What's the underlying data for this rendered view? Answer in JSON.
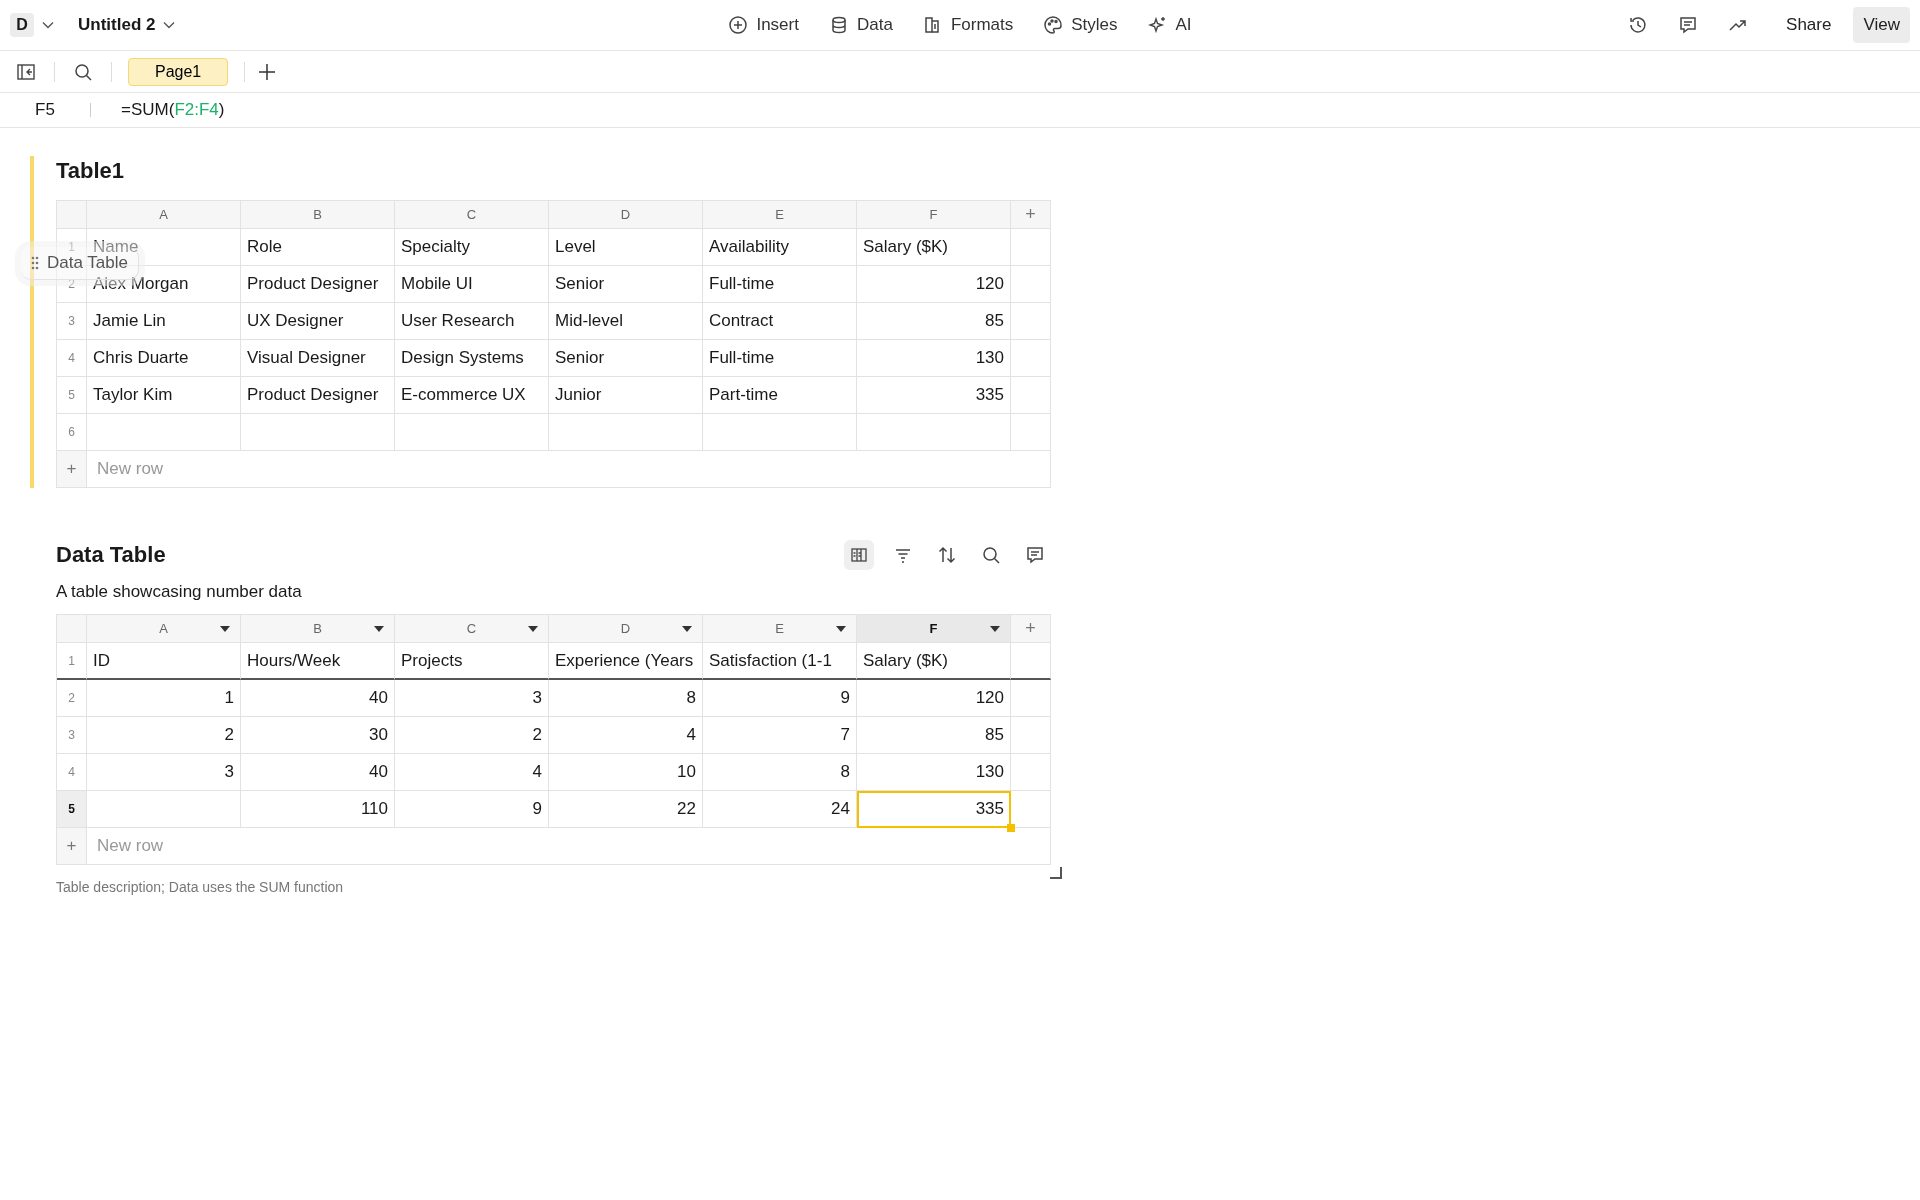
{
  "topbar": {
    "doc_initial": "D",
    "title": "Untitled 2",
    "menu": [
      {
        "kind": "insert",
        "label": "Insert"
      },
      {
        "kind": "data",
        "label": "Data"
      },
      {
        "kind": "formats",
        "label": "Formats"
      },
      {
        "kind": "styles",
        "label": "Styles"
      },
      {
        "kind": "ai",
        "label": "AI"
      }
    ],
    "right_icons": [
      {
        "kind": "history"
      },
      {
        "kind": "comment"
      },
      {
        "kind": "trend"
      }
    ],
    "buttons": [
      {
        "label": "Share",
        "selected": false
      },
      {
        "label": "View",
        "selected": true
      }
    ]
  },
  "pages": [
    {
      "label": "Page1",
      "selected": true
    }
  ],
  "formula_bar": {
    "cell": "F5",
    "formula_start": "=SUM(",
    "reference": "F2:F4",
    "formula_end": ")"
  },
  "tables": [
    {
      "title": "Table1",
      "highlighted": true,
      "drag_label": "Data Table",
      "columns": [
        {
          "label": "A",
          "selected": false,
          "menu": false
        },
        {
          "label": "B",
          "selected": false,
          "menu": false
        },
        {
          "label": "C",
          "selected": false,
          "menu": false
        },
        {
          "label": "D",
          "selected": false,
          "menu": false
        },
        {
          "label": "E",
          "selected": false,
          "menu": false
        },
        {
          "label": "F",
          "selected": false,
          "menu": false
        }
      ],
      "add_column": "+",
      "rows": [
        {
          "number": "1",
          "selected": false,
          "header": false,
          "cells": [
            {
              "kind": "text",
              "text": "Name",
              "selected": false
            },
            {
              "kind": "text",
              "text": "Role",
              "selected": false
            },
            {
              "kind": "text",
              "text": "Specialty",
              "selected": false
            },
            {
              "kind": "text",
              "text": "Level",
              "selected": false
            },
            {
              "kind": "text",
              "text": "Availability",
              "selected": false
            },
            {
              "kind": "text",
              "text": "Salary ($K)",
              "selected": false
            }
          ]
        },
        {
          "number": "2",
          "selected": false,
          "header": false,
          "cells": [
            {
              "kind": "text",
              "text": "Alex Morgan",
              "selected": false
            },
            {
              "kind": "text",
              "text": "Product Designer",
              "selected": false
            },
            {
              "kind": "text",
              "text": "Mobile UI",
              "selected": false
            },
            {
              "kind": "text",
              "text": "Senior",
              "selected": false
            },
            {
              "kind": "text",
              "text": "Full-time",
              "selected": false
            },
            {
              "kind": "number",
              "text": "120",
              "selected": false
            }
          ]
        },
        {
          "number": "3",
          "selected": false,
          "header": false,
          "cells": [
            {
              "kind": "text",
              "text": "Jamie Lin",
              "selected": false
            },
            {
              "kind": "text",
              "text": "UX Designer",
              "selected": false
            },
            {
              "kind": "text",
              "text": "User Research",
              "selected": false
            },
            {
              "kind": "text",
              "text": "Mid-level",
              "selected": false
            },
            {
              "kind": "text",
              "text": "Contract",
              "selected": false
            },
            {
              "kind": "number",
              "text": "85",
              "selected": false
            }
          ]
        },
        {
          "number": "4",
          "selected": false,
          "header": false,
          "cells": [
            {
              "kind": "text",
              "text": "Chris Duarte",
              "selected": false
            },
            {
              "kind": "text",
              "text": "Visual Designer",
              "selected": false
            },
            {
              "kind": "text",
              "text": "Design Systems",
              "selected": false
            },
            {
              "kind": "text",
              "text": "Senior",
              "selected": false
            },
            {
              "kind": "text",
              "text": "Full-time",
              "selected": false
            },
            {
              "kind": "number",
              "text": "130",
              "selected": false
            }
          ]
        },
        {
          "number": "5",
          "selected": false,
          "header": false,
          "cells": [
            {
              "kind": "text",
              "text": "Taylor Kim",
              "selected": false
            },
            {
              "kind": "text",
              "text": "Product Designer",
              "selected": false
            },
            {
              "kind": "text",
              "text": "E-commerce UX",
              "selected": false
            },
            {
              "kind": "text",
              "text": "Junior",
              "selected": false
            },
            {
              "kind": "text",
              "text": "Part-time",
              "selected": false
            },
            {
              "kind": "number",
              "text": "335",
              "selected": false
            }
          ]
        },
        {
          "number": "6",
          "selected": false,
          "header": false,
          "cells": [
            {
              "kind": "empty",
              "selected": false
            },
            {
              "kind": "empty",
              "selected": false
            },
            {
              "kind": "empty",
              "selected": false
            },
            {
              "kind": "empty",
              "selected": false
            },
            {
              "kind": "empty",
              "selected": false
            },
            {
              "kind": "empty",
              "selected": false
            }
          ]
        }
      ],
      "new_row": {
        "icon": "+",
        "label": "New row"
      }
    },
    {
      "title": "Data Table",
      "highlighted": false,
      "description": "A table showcasing number data",
      "tools": [
        {
          "kind": "columns",
          "selected": true
        },
        {
          "kind": "filter",
          "selected": false
        },
        {
          "kind": "sort",
          "selected": false
        },
        {
          "kind": "search",
          "selected": false
        },
        {
          "kind": "comment",
          "selected": false
        }
      ],
      "columns": [
        {
          "label": "A",
          "selected": false,
          "menu": true
        },
        {
          "label": "B",
          "selected": false,
          "menu": true
        },
        {
          "label": "C",
          "selected": false,
          "menu": true
        },
        {
          "label": "D",
          "selected": false,
          "menu": true
        },
        {
          "label": "E",
          "selected": false,
          "menu": true
        },
        {
          "label": "F",
          "selected": true,
          "menu": true
        }
      ],
      "add_column": "+",
      "rows": [
        {
          "number": "1",
          "selected": false,
          "header": true,
          "cells": [
            {
              "kind": "text",
              "text": "ID",
              "selected": false
            },
            {
              "kind": "text",
              "text": "Hours/Week",
              "selected": false
            },
            {
              "kind": "text",
              "text": "Projects",
              "selected": false
            },
            {
              "kind": "text",
              "text": "Experience (Years",
              "selected": false
            },
            {
              "kind": "text",
              "text": "Satisfaction (1-1",
              "selected": false
            },
            {
              "kind": "text",
              "text": "Salary ($K)",
              "selected": false
            }
          ]
        },
        {
          "number": "2",
          "selected": false,
          "header": false,
          "cells": [
            {
              "kind": "number",
              "text": "1",
              "selected": false
            },
            {
              "kind": "number",
              "text": "40",
              "selected": false
            },
            {
              "kind": "number",
              "text": "3",
              "selected": false
            },
            {
              "kind": "number",
              "text": "8",
              "selected": false
            },
            {
              "kind": "number",
              "text": "9",
              "selected": false
            },
            {
              "kind": "number",
              "text": "120",
              "selected": false
            }
          ]
        },
        {
          "number": "3",
          "selected": false,
          "header": false,
          "cells": [
            {
              "kind": "number",
              "text": "2",
              "selected": false
            },
            {
              "kind": "number",
              "text": "30",
              "selected": false
            },
            {
              "kind": "number",
              "text": "2",
              "selected": false
            },
            {
              "kind": "number",
              "text": "4",
              "selected": false
            },
            {
              "kind": "number",
              "text": "7",
              "selected": false
            },
            {
              "kind": "number",
              "text": "85",
              "selected": false
            }
          ]
        },
        {
          "number": "4",
          "selected": false,
          "header": false,
          "cells": [
            {
              "kind": "number",
              "text": "3",
              "selected": false
            },
            {
              "kind": "number",
              "text": "40",
              "selected": false
            },
            {
              "kind": "number",
              "text": "4",
              "selected": false
            },
            {
              "kind": "number",
              "text": "10",
              "selected": false
            },
            {
              "kind": "number",
              "text": "8",
              "selected": false
            },
            {
              "kind": "number",
              "text": "130",
              "selected": false
            }
          ]
        },
        {
          "number": "5",
          "selected": true,
          "header": false,
          "cells": [
            {
              "kind": "empty",
              "selected": false
            },
            {
              "kind": "number",
              "text": "110",
              "selected": false
            },
            {
              "kind": "number",
              "text": "9",
              "selected": false
            },
            {
              "kind": "number",
              "text": "22",
              "selected": false
            },
            {
              "kind": "number",
              "text": "24",
              "selected": false
            },
            {
              "kind": "number",
              "text": "335",
              "selected": true
            }
          ]
        }
      ],
      "new_row": {
        "icon": "+",
        "label": "New row"
      },
      "footer": "Table description; Data uses the SUM function"
    }
  ]
}
